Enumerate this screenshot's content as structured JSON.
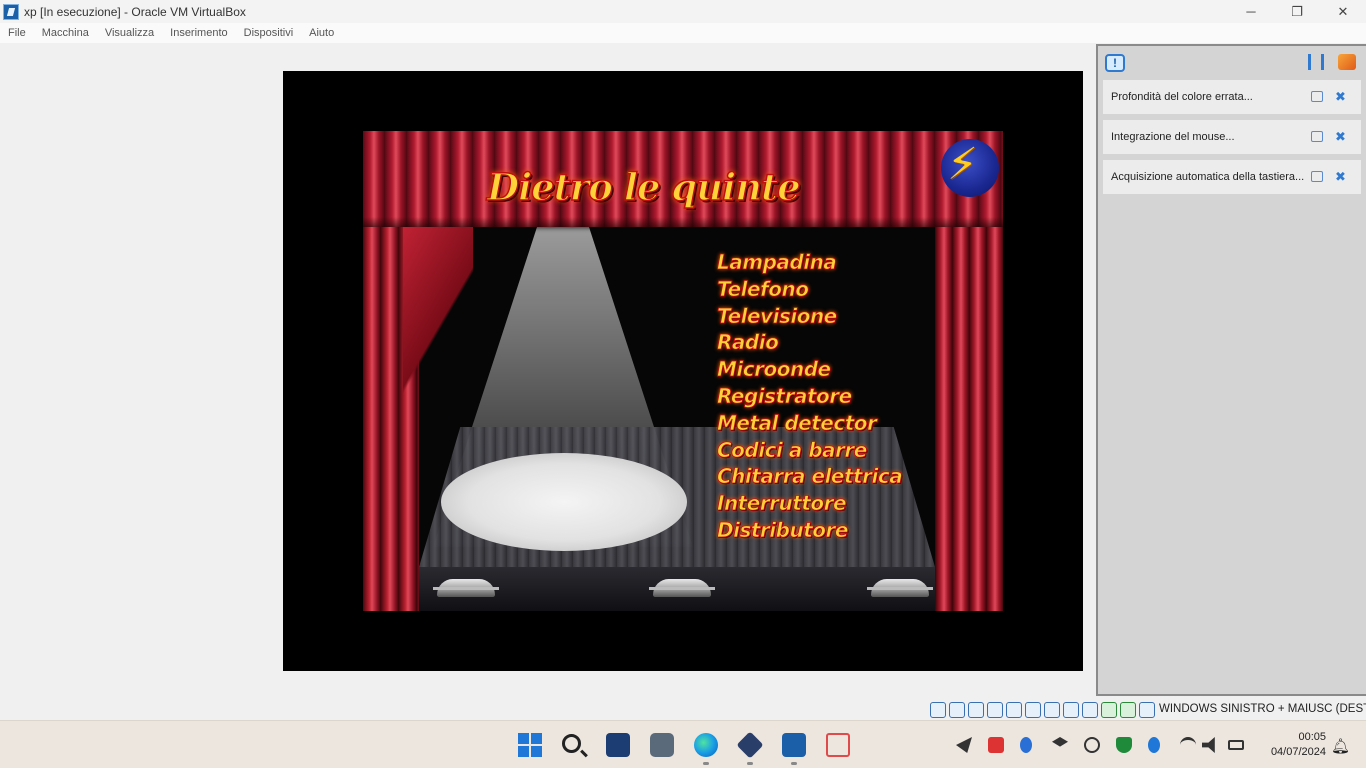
{
  "window": {
    "title": "xp [In esecuzione] - Oracle VM VirtualBox",
    "controls": {
      "minimize": "─",
      "restore": "❐",
      "close": "✕"
    }
  },
  "menu": [
    "File",
    "Macchina",
    "Visualizza",
    "Inserimento",
    "Dispositivi",
    "Aiuto"
  ],
  "guest": {
    "title": "Dietro le quinte",
    "items": [
      "Lampadina",
      "Telefono",
      "Televisione",
      "Radio",
      "Microonde",
      "Registratore",
      "Metal detector",
      "Codici a barre",
      "Chitarra elettrica",
      "Interruttore",
      "Distributore"
    ]
  },
  "notifications": {
    "bell_glyph": "!",
    "items": [
      "Profondità del colore errata...",
      "Integrazione del mouse...",
      "Acquisizione automatica della tastiera..."
    ],
    "dismiss_glyph": "✖"
  },
  "statusbar": {
    "host_key": "WINDOWS SINISTRO + MAIUSC (DESTRA)",
    "icons": [
      "hard-disk",
      "optical-drive",
      "floppy",
      "audio",
      "network",
      "usb",
      "shared-folders",
      "display",
      "recording",
      "cpu",
      "mouse-integration",
      "keyboard"
    ]
  },
  "taskbar": {
    "apps": [
      "start",
      "search",
      "virtualbox-manager",
      "camera",
      "edge",
      "virtualbox",
      "xp-vm",
      "snipping-tool"
    ],
    "time": "00:05",
    "date": "04/07/2024"
  },
  "colors": {
    "accent": "#1f78d8",
    "stage_text": "#ffd23a",
    "curtain": "#b01a2e"
  }
}
